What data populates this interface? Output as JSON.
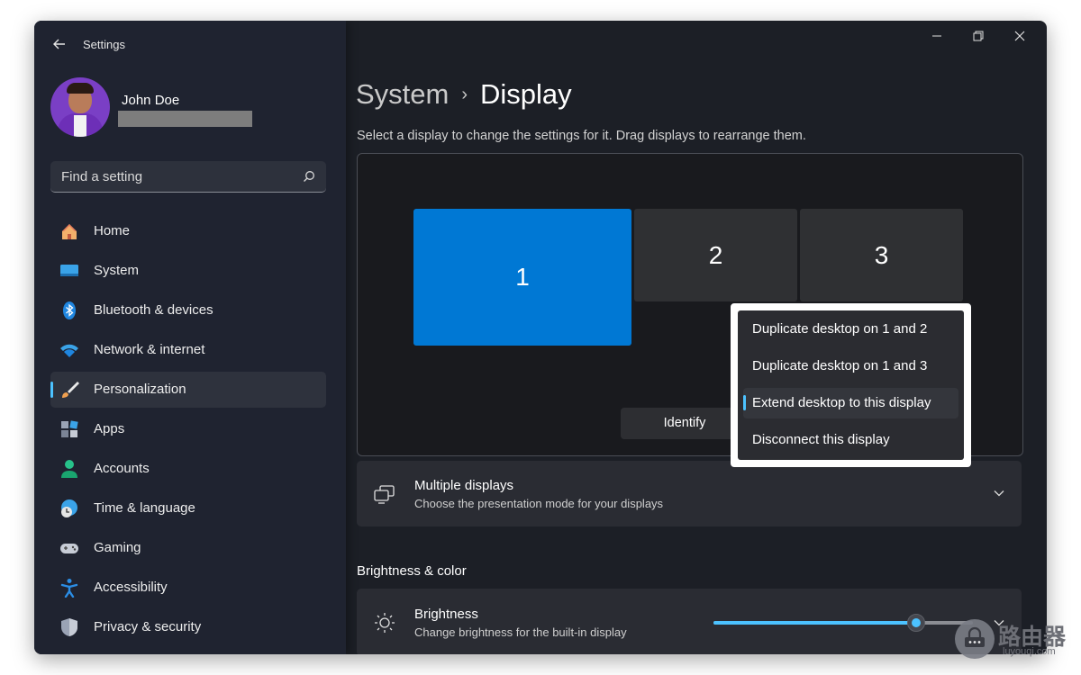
{
  "window": {
    "title": "Settings"
  },
  "user": {
    "name": "John Doe"
  },
  "search": {
    "placeholder": "Find a setting"
  },
  "sidebar": {
    "items": [
      {
        "label": "Home",
        "icon": "home-icon"
      },
      {
        "label": "System",
        "icon": "system-icon"
      },
      {
        "label": "Bluetooth & devices",
        "icon": "bluetooth-icon"
      },
      {
        "label": "Network & internet",
        "icon": "wifi-icon"
      },
      {
        "label": "Personalization",
        "icon": "brush-icon",
        "active": true
      },
      {
        "label": "Apps",
        "icon": "apps-icon"
      },
      {
        "label": "Accounts",
        "icon": "person-icon"
      },
      {
        "label": "Time & language",
        "icon": "globe-clock-icon"
      },
      {
        "label": "Gaming",
        "icon": "gamepad-icon"
      },
      {
        "label": "Accessibility",
        "icon": "accessibility-icon"
      },
      {
        "label": "Privacy & security",
        "icon": "shield-icon"
      }
    ]
  },
  "breadcrumb": {
    "parent": "System",
    "separator": "›",
    "current": "Display"
  },
  "display": {
    "subtitle": "Select a display to change the settings for it. Drag displays to rearrange them.",
    "monitors": [
      "1",
      "2",
      "3"
    ],
    "identify_label": "Identify"
  },
  "multiple_displays": {
    "title": "Multiple displays",
    "subtitle": "Choose the presentation mode for your displays"
  },
  "brightness_section": {
    "title": "Brightness & color"
  },
  "brightness": {
    "title": "Brightness",
    "subtitle": "Change brightness for the built-in display",
    "level": 0.78
  },
  "dropdown": {
    "items": [
      {
        "label": "Duplicate desktop on 1 and 2"
      },
      {
        "label": "Duplicate desktop on 1 and 3"
      },
      {
        "label": "Extend desktop to this display",
        "selected": true
      },
      {
        "label": "Disconnect this display"
      }
    ]
  },
  "watermark": {
    "text": "路由器",
    "url": "luyouqi.com"
  },
  "colors": {
    "accent": "#4cc2ff",
    "primary_monitor": "#0078d4",
    "background": "#1c1f26"
  }
}
